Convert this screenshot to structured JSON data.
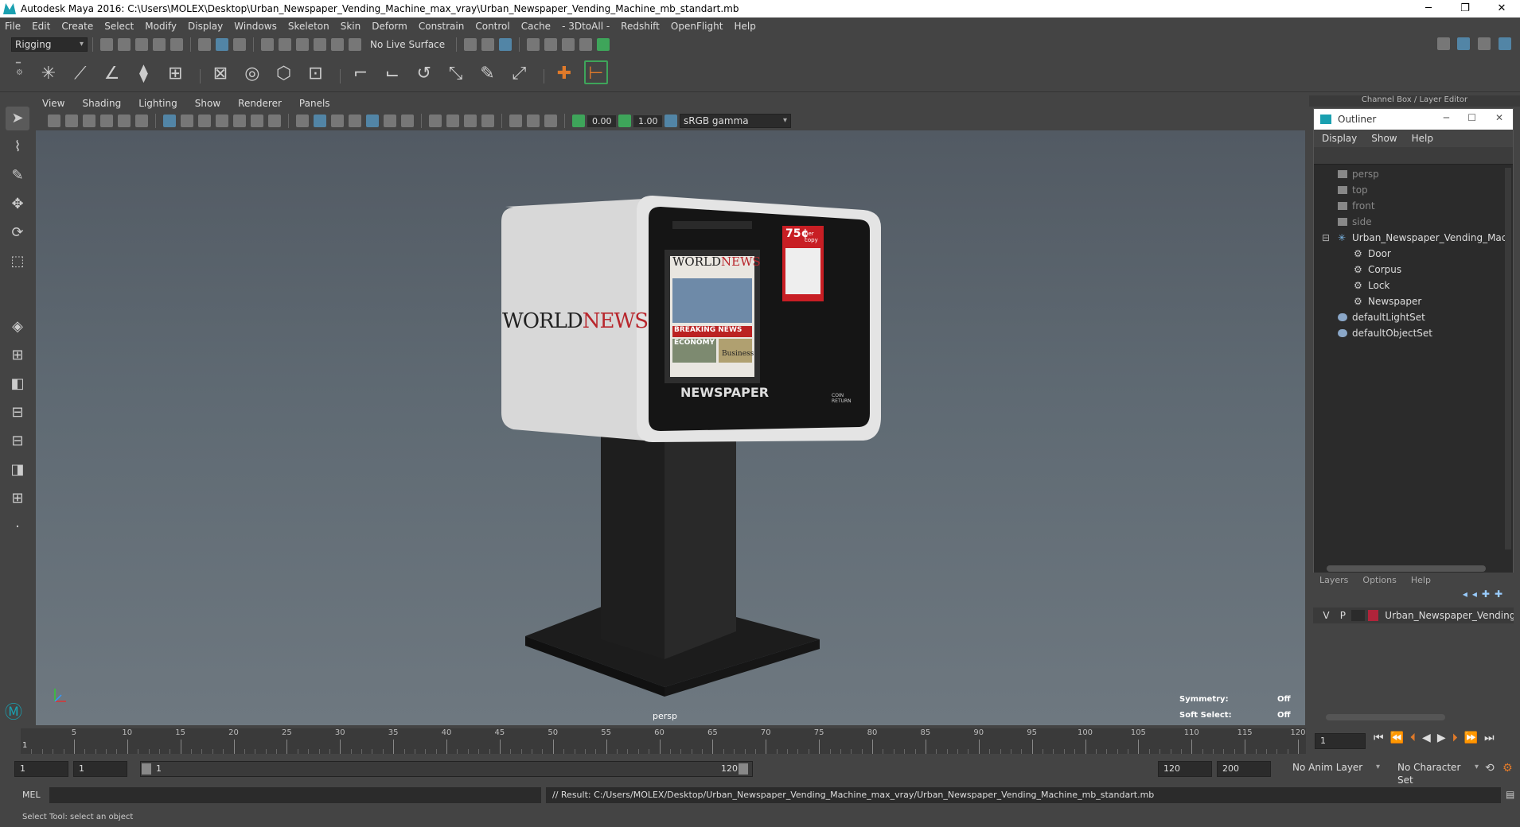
{
  "window": {
    "title": "Autodesk Maya 2016: C:\\Users\\MOLEX\\Desktop\\Urban_Newspaper_Vending_Machine_max_vray\\Urban_Newspaper_Vending_Machine_mb_standart.mb",
    "minimize": "─",
    "restore": "❐",
    "close": "✕"
  },
  "menubar": [
    "File",
    "Edit",
    "Create",
    "Select",
    "Modify",
    "Display",
    "Windows",
    "Skeleton",
    "Skin",
    "Deform",
    "Constrain",
    "Control",
    "Cache",
    "- 3DtoAll -",
    "Redshift",
    "OpenFlight",
    "Help"
  ],
  "statusline": {
    "mode": "Rigging",
    "live_surface": "No Live Surface"
  },
  "viewport": {
    "menus": [
      "View",
      "Shading",
      "Lighting",
      "Show",
      "Renderer",
      "Panels"
    ],
    "near_value": "0.00",
    "far_value": "1.00",
    "color_space": "sRGB gamma",
    "camera_label": "persp",
    "symmetry_label": "Symmetry:",
    "symmetry_value": "Off",
    "soft_select_label": "Soft Select:",
    "soft_select_value": "Off"
  },
  "model": {
    "side_brand_1": "WORLD",
    "side_brand_2": "NEWS",
    "front_label": "NEWSPAPER",
    "paper_title_1": "WORLD",
    "paper_title_2": "NEWS",
    "paper_headline": "BREAKING NEWS",
    "paper_sub": "ECONOMY",
    "paper_business": "Business",
    "price": "75¢",
    "price_sub": "per copy",
    "coin_return": "COIN RETURN"
  },
  "panel": {
    "header": "Channel Box / Layer Editor",
    "outliner_title": "Outliner",
    "outliner_menus": [
      "Display",
      "Show",
      "Help"
    ],
    "outliner_items": [
      {
        "label": "persp",
        "type": "camera",
        "indent": 0,
        "dim": true
      },
      {
        "label": "top",
        "type": "camera",
        "indent": 0,
        "dim": true
      },
      {
        "label": "front",
        "type": "camera",
        "indent": 0,
        "dim": true
      },
      {
        "label": "side",
        "type": "camera",
        "indent": 0,
        "dim": true
      },
      {
        "label": "Urban_Newspaper_Vending_Mac",
        "type": "group",
        "indent": 0,
        "dim": false
      },
      {
        "label": "Door",
        "type": "mesh",
        "indent": 1,
        "dim": false
      },
      {
        "label": "Corpus",
        "type": "mesh",
        "indent": 1,
        "dim": false
      },
      {
        "label": "Lock",
        "type": "mesh",
        "indent": 1,
        "dim": false
      },
      {
        "label": "Newspaper",
        "type": "mesh",
        "indent": 1,
        "dim": false
      },
      {
        "label": "defaultLightSet",
        "type": "set",
        "indent": 0,
        "dim": false
      },
      {
        "label": "defaultObjectSet",
        "type": "set",
        "indent": 0,
        "dim": false
      }
    ],
    "layer_menus": [
      "Layers",
      "Options",
      "Help"
    ],
    "layer_v": "V",
    "layer_p": "P",
    "layer_name": "Urban_Newspaper_Vending_",
    "layer_color": "#b0243a"
  },
  "timeline": {
    "ticks": [
      "5",
      "10",
      "15",
      "20",
      "25",
      "30",
      "35",
      "40",
      "45",
      "50",
      "55",
      "60",
      "65",
      "70",
      "75",
      "80",
      "85",
      "90",
      "95",
      "100",
      "105",
      "110",
      "115",
      "120"
    ],
    "start_marker": "1",
    "current_frame": "1"
  },
  "range": {
    "start": "1",
    "playback_start": "1",
    "slider_start": "1",
    "slider_end": "120",
    "playback_end": "120",
    "end": "200",
    "anim_layer": "No Anim Layer",
    "character_set": "No Character Set"
  },
  "cmdline": {
    "lang": "MEL",
    "result": "// Result: C:/Users/MOLEX/Desktop/Urban_Newspaper_Vending_Machine_max_vray/Urban_Newspaper_Vending_Machine_mb_standart.mb"
  },
  "helpline": "Select Tool: select an object"
}
